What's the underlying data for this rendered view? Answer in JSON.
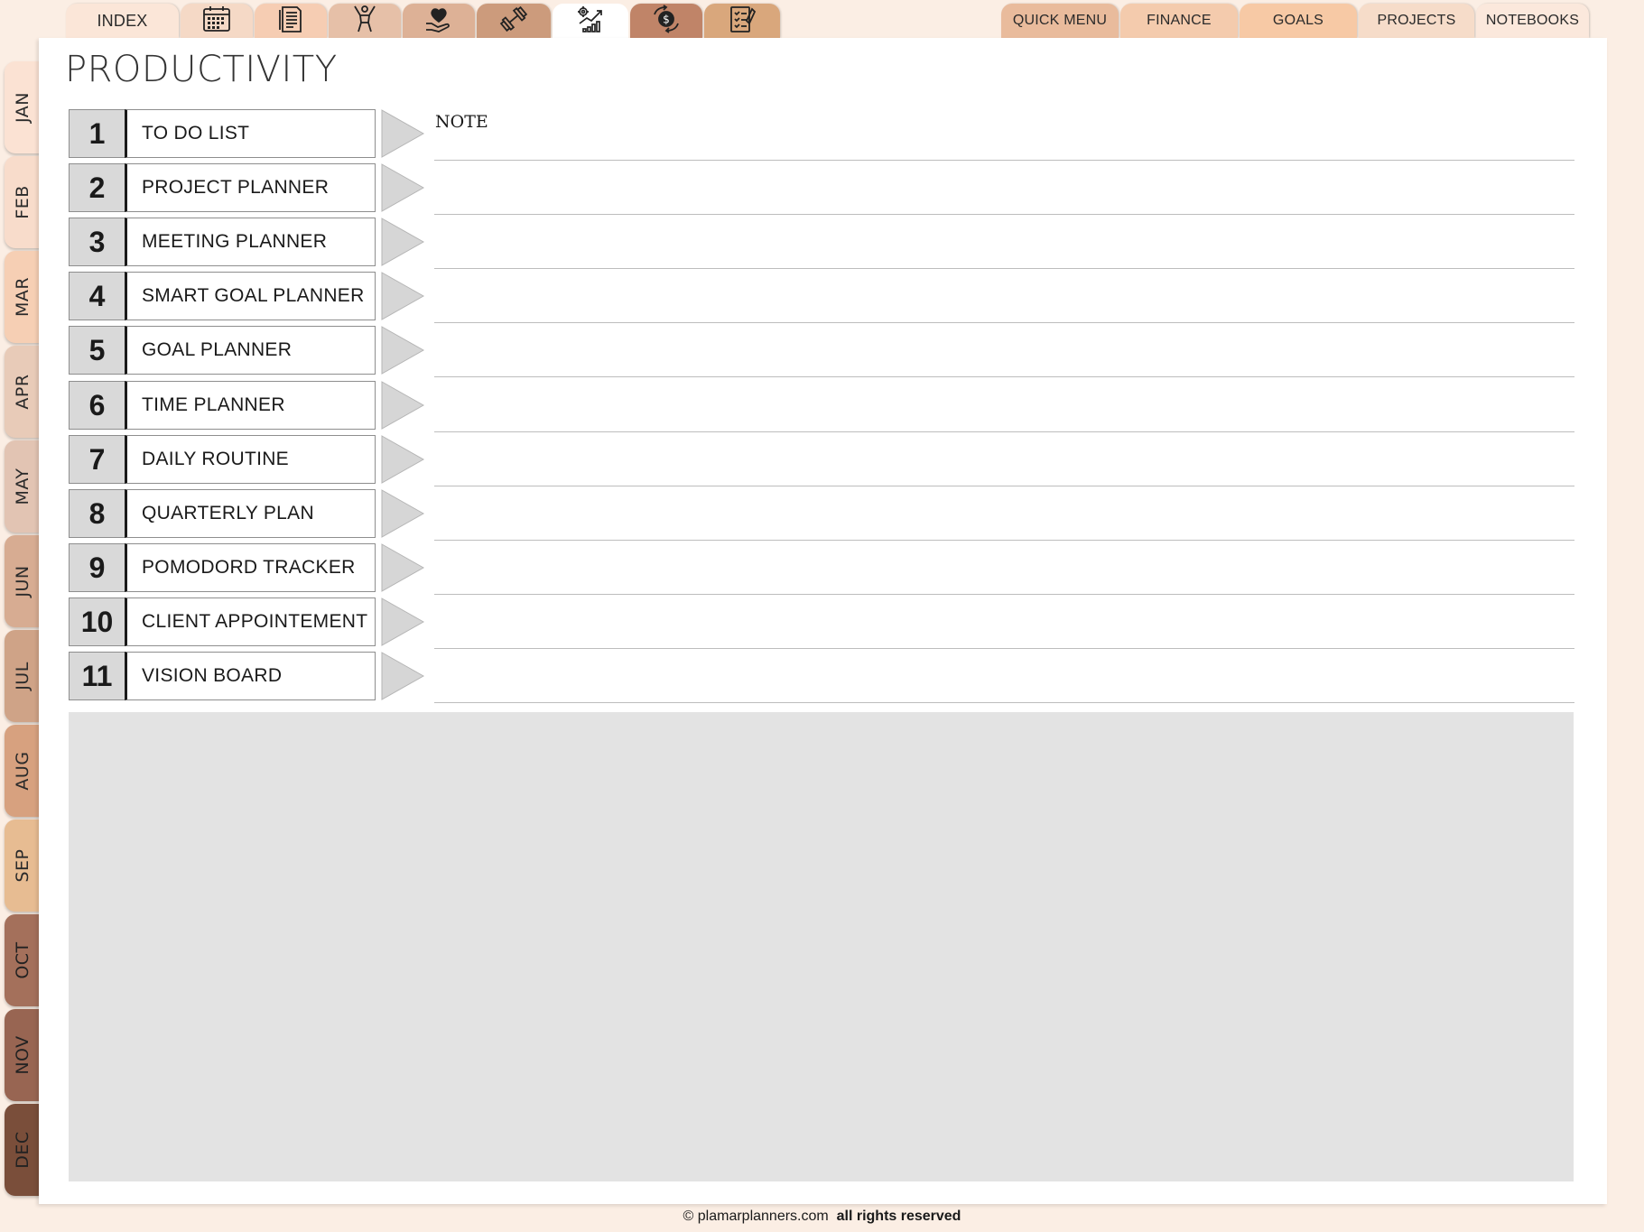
{
  "top_tabs_left": [
    {
      "label": "INDEX",
      "color": "#fbe6d8"
    },
    {
      "icon": "calendar-icon",
      "color": "#f5d9c6"
    },
    {
      "icon": "document-icon",
      "color": "#f6cdb3"
    },
    {
      "icon": "fitness-person-icon",
      "color": "#e6c0a8"
    },
    {
      "icon": "heart-hand-icon",
      "color": "#ddb196"
    },
    {
      "icon": "dumbbell-icon",
      "color": "#cc9b7c"
    },
    {
      "icon": "productivity-growth-icon",
      "color": "#ffffff",
      "active": true
    },
    {
      "icon": "money-cycle-icon",
      "color": "#c08468"
    },
    {
      "icon": "checklist-icon",
      "color": "#d9a77c"
    }
  ],
  "top_tabs_right": [
    {
      "label": "QUICK MENU",
      "color": "#e9bb9c"
    },
    {
      "label": "FINANCE",
      "color": "#f4cbad"
    },
    {
      "label": "GOALS",
      "color": "#f7c9a5"
    },
    {
      "label": "PROJECTS",
      "color": "#f6dcc9"
    },
    {
      "label": "NOTEBOOKS",
      "color": "#fbe8dc"
    }
  ],
  "months": [
    {
      "label": "JAN",
      "color": "#fbe2d3"
    },
    {
      "label": "FEB",
      "color": "#f8dccb"
    },
    {
      "label": "MAR",
      "color": "#f6cfb4"
    },
    {
      "label": "APR",
      "color": "#e8cbb8"
    },
    {
      "label": "MAY",
      "color": "#e2c4b3"
    },
    {
      "label": "JUN",
      "color": "#d7ac92"
    },
    {
      "label": "JUL",
      "color": "#cfa387"
    },
    {
      "label": "AUG",
      "color": "#d7a17f"
    },
    {
      "label": "SEP",
      "color": "#e7bc92"
    },
    {
      "label": "OCT",
      "color": "#a4705b"
    },
    {
      "label": "NOV",
      "color": "#986552"
    },
    {
      "label": "DEC",
      "color": "#7a4e3a"
    }
  ],
  "page": {
    "title": "PRODUCTIVITY",
    "note_label": "NOTE",
    "items": [
      {
        "num": "1",
        "label": "TO DO LIST"
      },
      {
        "num": "2",
        "label": "PROJECT PLANNER"
      },
      {
        "num": "3",
        "label": "MEETING PLANNER"
      },
      {
        "num": "4",
        "label": "SMART GOAL PLANNER"
      },
      {
        "num": "5",
        "label": "GOAL PLANNER"
      },
      {
        "num": "6",
        "label": "TIME PLANNER"
      },
      {
        "num": "7",
        "label": "DAILY ROUTINE"
      },
      {
        "num": "8",
        "label": "QUARTERLY PLAN"
      },
      {
        "num": "9",
        "label": "POMODORD TRACKER"
      },
      {
        "num": "10",
        "label": "CLIENT APPOINTEMENT"
      },
      {
        "num": "11",
        "label": "VISION BOARD"
      }
    ]
  },
  "footer": {
    "site": "© plamarplanners.com",
    "rights": "all rights reserved"
  }
}
